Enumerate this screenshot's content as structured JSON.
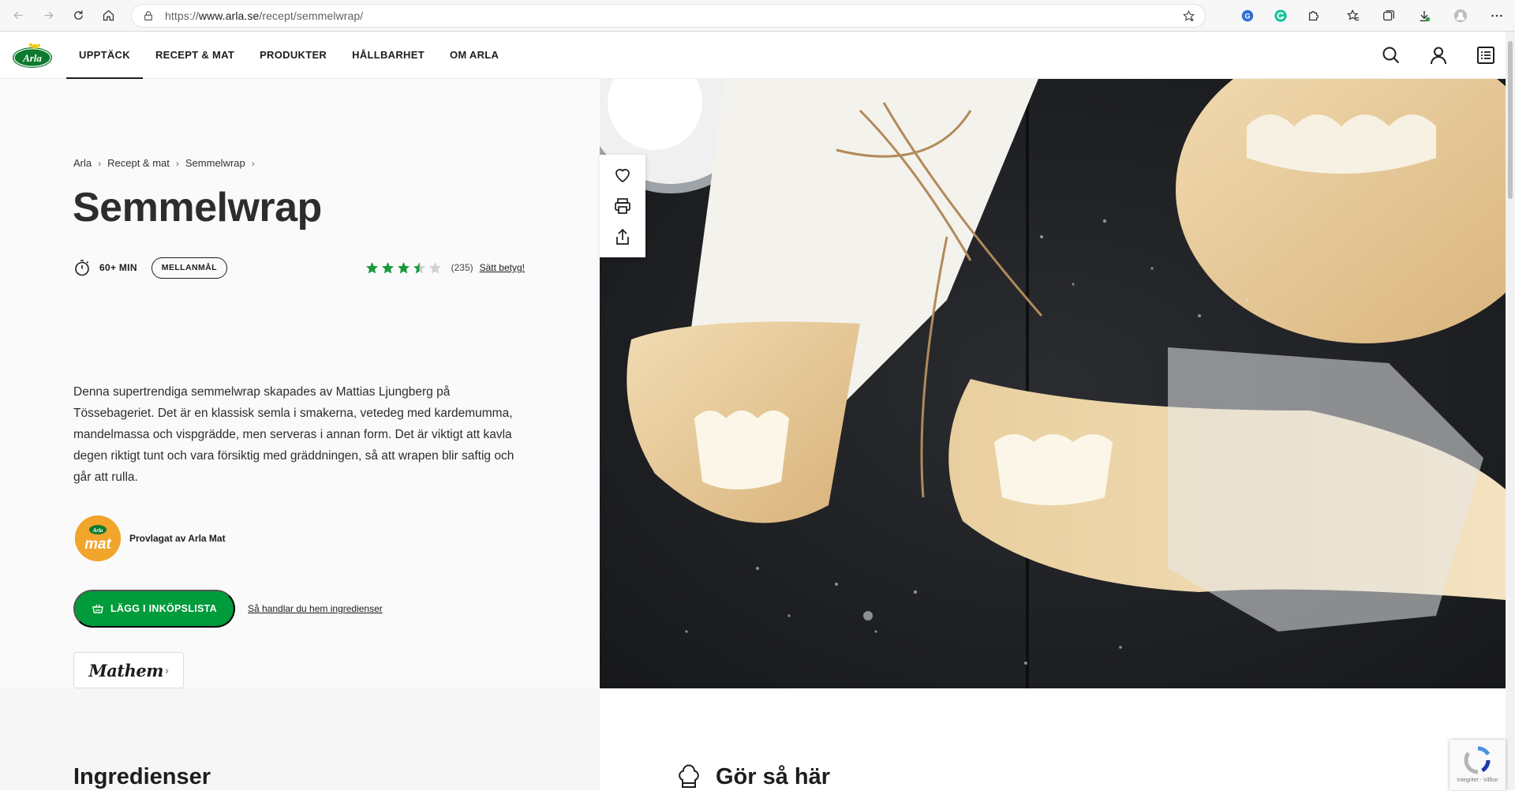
{
  "browser": {
    "url_prefix": "https://",
    "url_domain": "www.arla.se",
    "url_path": "/recept/semmelwrap/"
  },
  "site": {
    "logo_text": "Arla",
    "nav": [
      {
        "label": "UPPTÄCK",
        "active": true
      },
      {
        "label": "RECEPT & MAT",
        "active": false
      },
      {
        "label": "PRODUKTER",
        "active": false
      },
      {
        "label": "HÅLLBARHET",
        "active": false
      },
      {
        "label": "OM ARLA",
        "active": false
      }
    ],
    "header_icons": [
      "search-icon",
      "user-icon",
      "shopping-list-icon"
    ]
  },
  "recipe": {
    "breadcrumbs": [
      "Arla",
      "Recept & mat",
      "Semmelwrap"
    ],
    "title": "Semmelwrap",
    "time": "60+ MIN",
    "tag": "MELLANMÅL",
    "rating": 3.5,
    "rating_max": 5,
    "rating_count": "(235)",
    "rate_link": "Sätt betyg!",
    "description": "Denna supertrendiga semmelwrap skapades av Mattias Ljungberg på Tössebageriet. Det är en klassisk semla i smakerna, vetedeg med kardemumma, mandelmassa och vispgrädde, men serveras i annan form. Det är viktigt att kavla degen riktigt tunt och vara försiktig med gräddningen, så att wrapen blir saftig och går att rulla.",
    "tested_badge_top": "Arla",
    "tested_badge": "mat",
    "tested_by": "Provlagat av Arla Mat",
    "shop_button": "LÄGG I INKÖPSLISTA",
    "shop_link": "Så handlar du hem ingredienser",
    "partner": "Mathem"
  },
  "actions": [
    "heart-icon",
    "print-icon",
    "share-icon"
  ],
  "sections": {
    "ingredients_title": "Ingredienser",
    "howto_title": "Gör så här"
  },
  "recaptcha_text": "Integritet - Villkor",
  "colors": {
    "brand_green": "#009b3a",
    "star_green": "#1a9a3c",
    "star_empty": "#d0d0d0",
    "badge_orange": "#f1a52a"
  }
}
